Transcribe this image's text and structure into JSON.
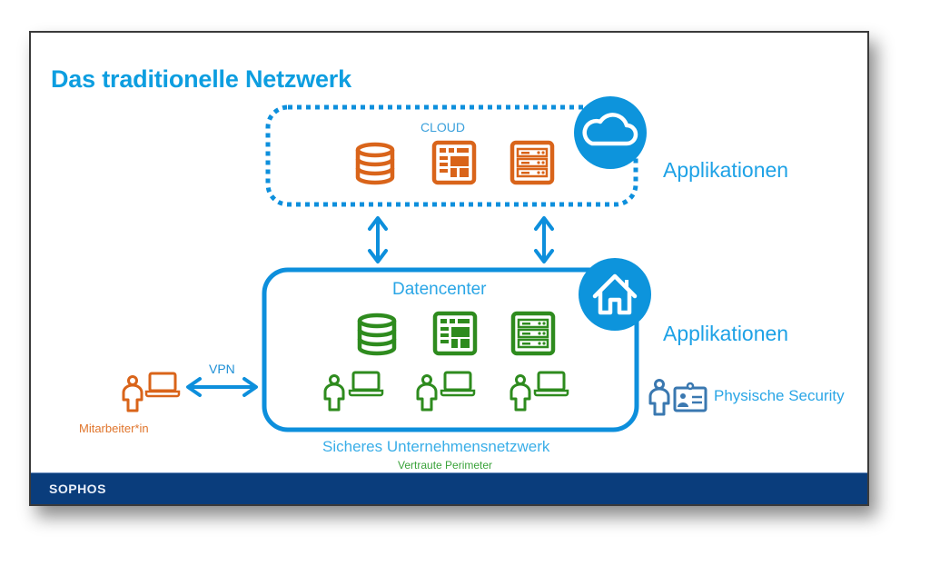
{
  "slide": {
    "title": "Das traditionelle Netzwerk",
    "footer_logo": "SOPHOS"
  },
  "cloud": {
    "label": "CLOUD",
    "icons": [
      "database-icon",
      "web-app-icon",
      "server-icon"
    ],
    "badge_icon": "cloud-icon",
    "side_label": "Applikationen"
  },
  "datacenter": {
    "label": "Datencenter",
    "icons": [
      "database-icon",
      "web-app-icon",
      "server-icon"
    ],
    "users": [
      "user-laptop-icon",
      "user-laptop-icon",
      "user-laptop-icon"
    ],
    "badge_icon": "house-icon",
    "side_label": "Applikationen",
    "caption": "Sicheres Unternehmensnetzwerk",
    "subcaption": "Vertraute Perimeter"
  },
  "remote": {
    "vpn_label": "VPN",
    "user_label": "Mitarbeiter*in"
  },
  "physical": {
    "label": "Physische Security"
  },
  "colors": {
    "blue": "#0d9ee0",
    "cloud_orange": "#d9641a",
    "datacenter_green": "#2e8b1e",
    "footer_navy": "#0a3d7c",
    "physical_steel": "#3a78b0"
  }
}
